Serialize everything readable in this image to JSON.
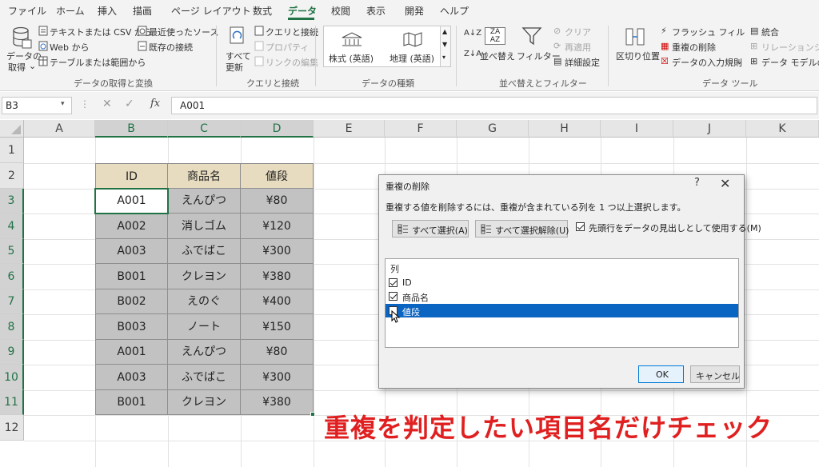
{
  "ribbon_tabs": [
    "ファイル",
    "ホーム",
    "挿入",
    "描画",
    "ページ レイアウト",
    "数式",
    "データ",
    "校閲",
    "表示",
    "開発",
    "ヘルプ"
  ],
  "active_tab": "データ",
  "ribbon": {
    "get_data": {
      "label_line1": "データの",
      "label_line2": "取得"
    },
    "text_csv": "テキストまたは CSV から",
    "from_web": "Web から",
    "from_table": "テーブルまたは範囲から",
    "recent_sources": "最近使ったソース",
    "existing_conn": "既存の接続",
    "group_get_transform": "データの取得と変換",
    "refresh_all": {
      "line1": "すべて",
      "line2": "更新"
    },
    "queries_conn": "クエリと接続",
    "properties": "プロパティ",
    "edit_links": "リンクの編集",
    "group_queries": "クエリと接続",
    "stocks": "株式 (英語)",
    "geography": "地理 (英語)",
    "group_data_types": "データの種類",
    "sort": "並べ替え",
    "filter": "フィルター",
    "clear": "クリア",
    "reapply": "再適用",
    "advanced": "詳細設定",
    "group_sort_filter": "並べ替えとフィルター",
    "text_to_columns": "区切り位置",
    "flash_fill": "フラッシュ フィル",
    "remove_duplicates": "重複の削除",
    "data_validation": "データの入力規則",
    "consolidate": "統合",
    "relationships": "リレーションシップ",
    "data_model": "データ モデルの管",
    "group_data_tools": "データ ツール"
  },
  "formula_bar": {
    "name_box": "B3",
    "fx": "fx",
    "value": "A001"
  },
  "columns": [
    "A",
    "B",
    "C",
    "D",
    "E",
    "F",
    "G",
    "H",
    "I",
    "J",
    "K"
  ],
  "rows": [
    "1",
    "2",
    "3",
    "4",
    "5",
    "6",
    "7",
    "8",
    "9",
    "10",
    "11",
    "12"
  ],
  "table": {
    "headers": [
      "ID",
      "商品名",
      "値段"
    ],
    "rows": [
      [
        "A001",
        "えんぴつ",
        "¥80"
      ],
      [
        "A002",
        "消しゴム",
        "¥120"
      ],
      [
        "A003",
        "ふでばこ",
        "¥300"
      ],
      [
        "B001",
        "クレヨン",
        "¥380"
      ],
      [
        "B002",
        "えのぐ",
        "¥400"
      ],
      [
        "B003",
        "ノート",
        "¥150"
      ],
      [
        "A001",
        "えんぴつ",
        "¥80"
      ],
      [
        "A003",
        "ふでばこ",
        "¥300"
      ],
      [
        "B001",
        "クレヨン",
        "¥380"
      ]
    ]
  },
  "annotation": "重複を判定したい項目名だけチェック",
  "dialog": {
    "title": "重複の削除",
    "help": "?",
    "close": "✕",
    "description": "重複する値を削除するには、重複が含まれている列を 1 つ以上選択します。",
    "select_all": "すべて選択(A)",
    "unselect_all": "すべて選択解除(U)",
    "header_checkbox": "先頭行をデータの見出しとして使用する(M)",
    "header_checked": true,
    "list_header": "列",
    "columns": [
      {
        "label": "ID",
        "checked": true
      },
      {
        "label": "商品名",
        "checked": true
      },
      {
        "label": "値段",
        "checked": false
      }
    ],
    "ok": "OK",
    "cancel": "キャンセル"
  }
}
